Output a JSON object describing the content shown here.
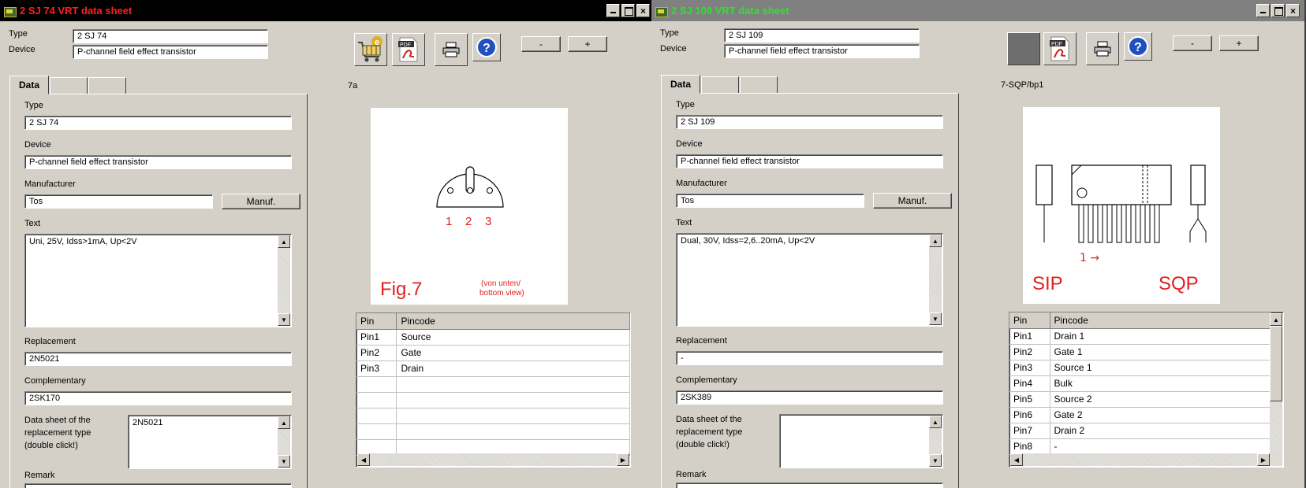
{
  "window1": {
    "title": "2 SJ 74 VRT data sheet",
    "header": {
      "type_label": "Type",
      "type_value": "2 SJ 74",
      "device_label": "Device",
      "device_value": "P-channel field effect transistor"
    },
    "nav": {
      "minus": "-",
      "plus": "+"
    },
    "tabs": [
      "Data",
      "",
      ""
    ],
    "form": {
      "type_label": "Type",
      "type_value": "2 SJ 74",
      "device_label": "Device",
      "device_value": "P-channel field effect transistor",
      "manufacturer_label": "Manufacturer",
      "manufacturer_value": "Tos",
      "manuf_button": "Manuf.",
      "text_label": "Text",
      "text_value": "Uni, 25V, Idss>1mA, Up<2V",
      "replacement_label": "Replacement",
      "replacement_value": "2N5021",
      "complementary_label": "Complementary",
      "complementary_value": "2SK170",
      "datasheet_label_1": "Data sheet of the",
      "datasheet_label_2": "replacement type",
      "datasheet_label_3": "(double click!)",
      "datasheet_value": "2N5021",
      "remark_label": "Remark"
    },
    "package_code": "7a",
    "figure": {
      "pins": [
        "1",
        "2",
        "3"
      ],
      "caption": "Fig.7",
      "view_1": "(von unten/",
      "view_2": "bottom view)"
    },
    "pins": {
      "headers": [
        "Pin",
        "Pincode"
      ],
      "rows": [
        [
          "Pin1",
          "Source"
        ],
        [
          "Pin2",
          "Gate"
        ],
        [
          "Pin3",
          "Drain"
        ],
        [
          "",
          ""
        ],
        [
          "",
          ""
        ],
        [
          "",
          ""
        ],
        [
          "",
          ""
        ],
        [
          "",
          ""
        ]
      ]
    }
  },
  "window2": {
    "title": "2 SJ 109 VRT data sheet",
    "header": {
      "type_label": "Type",
      "type_value": "2 SJ 109",
      "device_label": "Device",
      "device_value": "P-channel field effect transistor"
    },
    "nav": {
      "minus": "-",
      "plus": "+"
    },
    "tabs": [
      "Data",
      "",
      ""
    ],
    "form": {
      "type_label": "Type",
      "type_value": "2 SJ 109",
      "device_label": "Device",
      "device_value": "P-channel field effect transistor",
      "manufacturer_label": "Manufacturer",
      "manufacturer_value": "Tos",
      "manuf_button": "Manuf.",
      "text_label": "Text",
      "text_value": "Dual, 30V, Idss=2,6..20mA, Up<2V",
      "replacement_label": "Replacement",
      "replacement_value": "-",
      "complementary_label": "Complementary",
      "complementary_value": "2SK389",
      "datasheet_label_1": "Data sheet of the",
      "datasheet_label_2": "replacement type",
      "datasheet_label_3": "(double click!)",
      "datasheet_value": "",
      "remark_label": "Remark"
    },
    "package_code": "7-SQP/bp1",
    "figure": {
      "pin1": "1 →",
      "left_caption": "SIP",
      "right_caption": "SQP"
    },
    "pins": {
      "headers": [
        "Pin",
        "Pincode"
      ],
      "rows": [
        [
          "Pin1",
          "Drain 1"
        ],
        [
          "Pin2",
          "Gate 1"
        ],
        [
          "Pin3",
          "Source 1"
        ],
        [
          "Pin4",
          "Bulk"
        ],
        [
          "Pin5",
          "Source 2"
        ],
        [
          "Pin6",
          "Gate 2"
        ],
        [
          "Pin7",
          "Drain 2"
        ],
        [
          "Pin8",
          "-"
        ]
      ]
    }
  },
  "colors": {
    "w1_title_bg": "#000000",
    "w1_title_text": "#ff2020",
    "w2_title_bg": "#808080",
    "w2_title_text": "#30e030",
    "figure_red": "#e02020"
  }
}
